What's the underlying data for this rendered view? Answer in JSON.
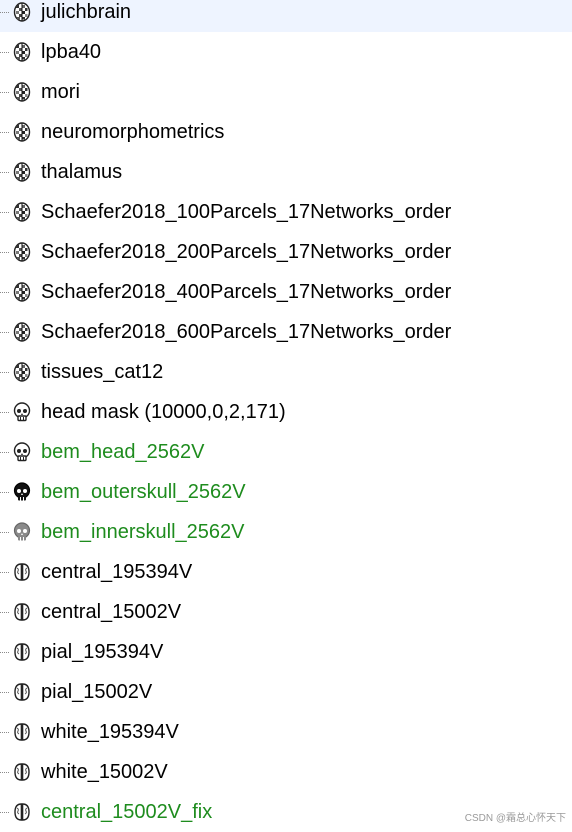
{
  "colors": {
    "text_default": "#000000",
    "text_highlight": "#1e8c1e",
    "tree_dots": "#8a8a8a"
  },
  "items": [
    {
      "label": "julichbrain",
      "icon": "atlas-icon",
      "highlighted": false
    },
    {
      "label": "lpba40",
      "icon": "atlas-icon",
      "highlighted": false
    },
    {
      "label": "mori",
      "icon": "atlas-icon",
      "highlighted": false
    },
    {
      "label": "neuromorphometrics",
      "icon": "atlas-icon",
      "highlighted": false
    },
    {
      "label": "thalamus",
      "icon": "atlas-icon",
      "highlighted": false
    },
    {
      "label": "Schaefer2018_100Parcels_17Networks_order",
      "icon": "atlas-icon",
      "highlighted": false
    },
    {
      "label": "Schaefer2018_200Parcels_17Networks_order",
      "icon": "atlas-icon",
      "highlighted": false
    },
    {
      "label": "Schaefer2018_400Parcels_17Networks_order",
      "icon": "atlas-icon",
      "highlighted": false
    },
    {
      "label": "Schaefer2018_600Parcels_17Networks_order",
      "icon": "atlas-icon",
      "highlighted": false
    },
    {
      "label": "tissues_cat12",
      "icon": "atlas-icon",
      "highlighted": false
    },
    {
      "label": "head mask (10000,0,2,171)",
      "icon": "head-mask-icon",
      "highlighted": false
    },
    {
      "label": "bem_head_2562V",
      "icon": "head-surface-icon",
      "highlighted": true
    },
    {
      "label": "bem_outerskull_2562V",
      "icon": "outer-skull-icon",
      "highlighted": true
    },
    {
      "label": "bem_innerskull_2562V",
      "icon": "inner-skull-icon",
      "highlighted": true
    },
    {
      "label": "central_195394V",
      "icon": "cortex-surface-icon",
      "highlighted": false
    },
    {
      "label": "central_15002V",
      "icon": "cortex-surface-icon",
      "highlighted": false
    },
    {
      "label": "pial_195394V",
      "icon": "cortex-surface-icon",
      "highlighted": false
    },
    {
      "label": "pial_15002V",
      "icon": "cortex-surface-icon",
      "highlighted": false
    },
    {
      "label": "white_195394V",
      "icon": "cortex-surface-icon",
      "highlighted": false
    },
    {
      "label": "white_15002V",
      "icon": "cortex-surface-icon",
      "highlighted": false
    },
    {
      "label": "central_15002V_fix",
      "icon": "cortex-surface-icon",
      "highlighted": true
    }
  ],
  "watermark": "CSDN @霜总心怀天下"
}
